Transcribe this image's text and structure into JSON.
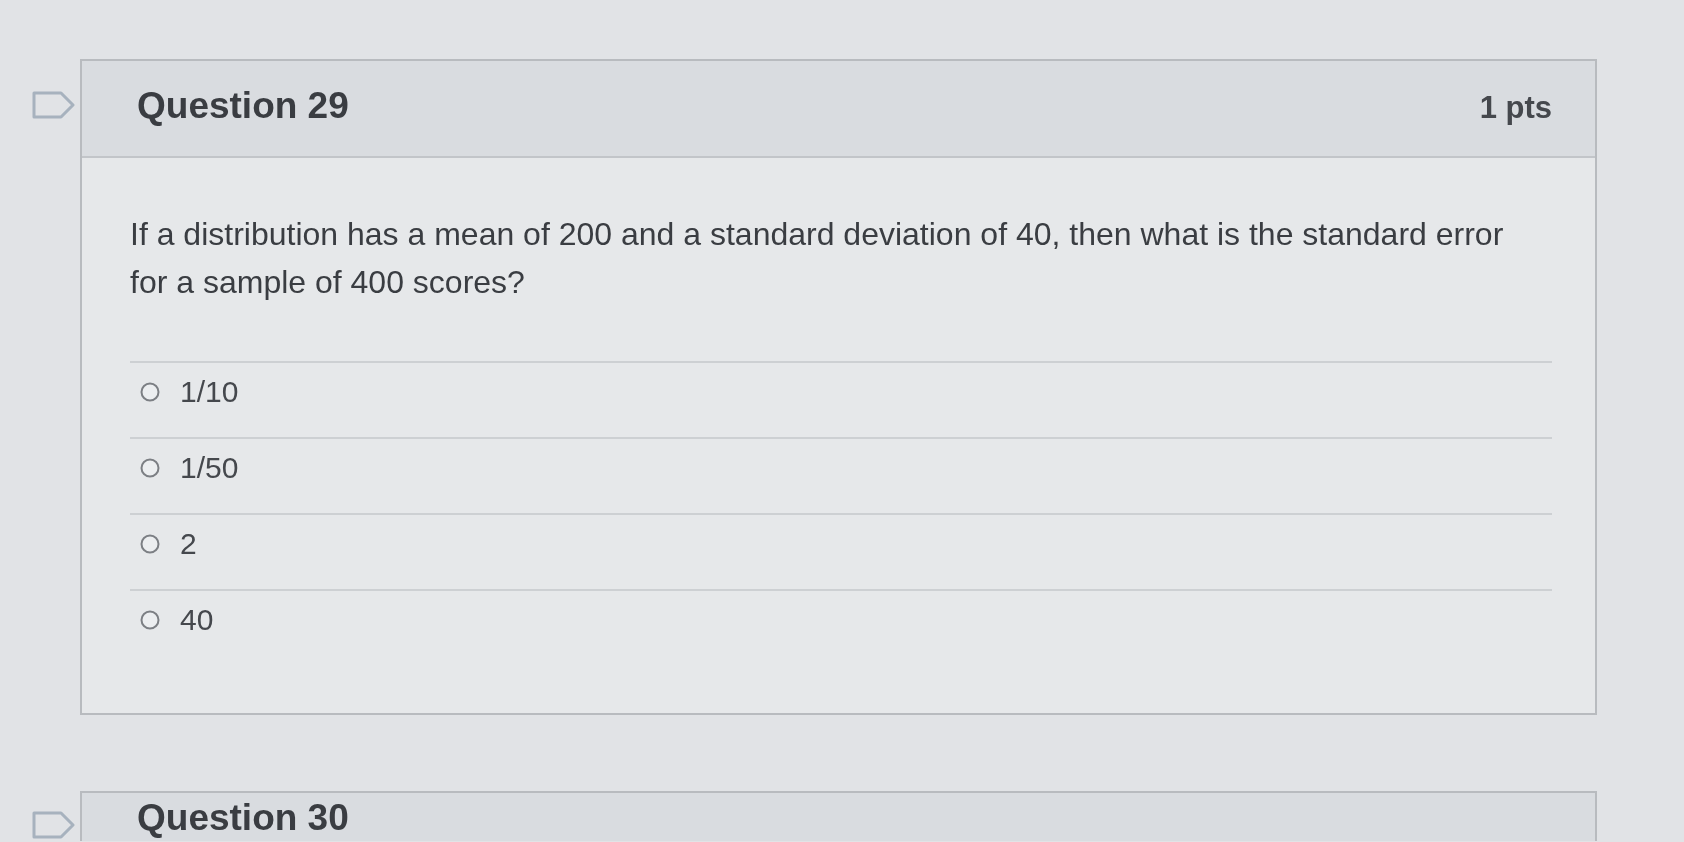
{
  "questions": [
    {
      "title": "Question 29",
      "points": "1 pts",
      "text": "If a distribution has a mean of 200 and a standard deviation of 40, then what is the standard error for a sample of 400 scores?",
      "options": [
        {
          "label": "1/10",
          "selected": false
        },
        {
          "label": "1/50",
          "selected": false
        },
        {
          "label": "2",
          "selected": false
        },
        {
          "label": "40",
          "selected": false
        }
      ]
    },
    {
      "title": "Question 30"
    }
  ]
}
